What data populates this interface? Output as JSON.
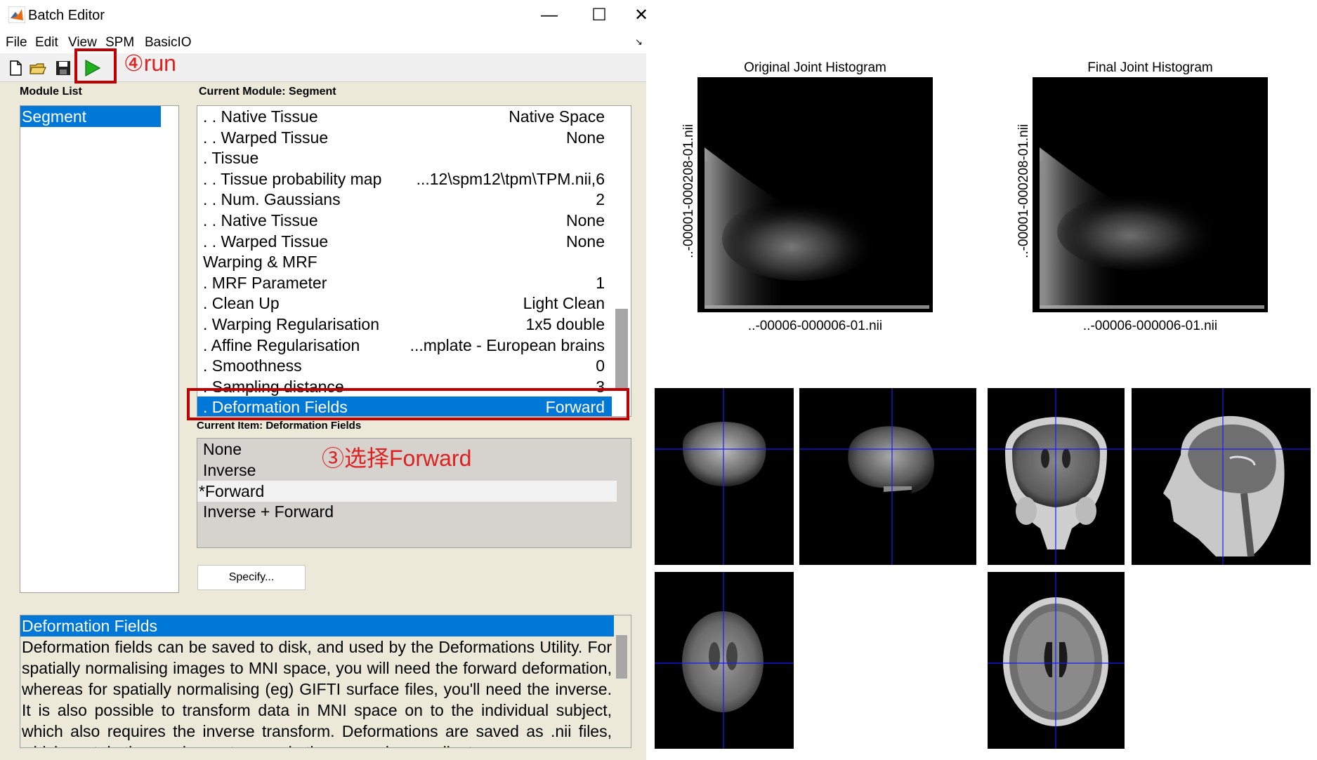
{
  "window": {
    "title": "Batch Editor",
    "controls": {
      "minimize": "—",
      "maximize": "☐",
      "close": "✕"
    }
  },
  "menu": [
    "File",
    "Edit",
    "View",
    "SPM",
    "BasicIO"
  ],
  "panels": {
    "module_list_label": "Module List",
    "current_module_label": "Current Module: Segment",
    "current_item_label": "Current Item: Deformation Fields"
  },
  "module_list": [
    "Segment"
  ],
  "current_module_rows": [
    {
      "label": ". . Native Tissue",
      "value": "Native Space"
    },
    {
      "label": ". . Warped Tissue",
      "value": "None"
    },
    {
      "label": ". Tissue",
      "value": ""
    },
    {
      "label": ". . Tissue probability map",
      "value": "...12\\spm12\\tpm\\TPM.nii,6"
    },
    {
      "label": ". . Num. Gaussians",
      "value": "2"
    },
    {
      "label": ". . Native Tissue",
      "value": "None"
    },
    {
      "label": ". . Warped Tissue",
      "value": "None"
    },
    {
      "label": "Warping & MRF",
      "value": ""
    },
    {
      "label": ". MRF Parameter",
      "value": "1"
    },
    {
      "label": ". Clean Up",
      "value": "Light Clean"
    },
    {
      "label": ". Warping Regularisation",
      "value": "1x5 double"
    },
    {
      "label": ". Affine Regularisation",
      "value": "...mplate - European brains"
    },
    {
      "label": ". Smoothness",
      "value": "0"
    },
    {
      "label": ". Sampling distance",
      "value": "3"
    },
    {
      "label": ". Deformation Fields",
      "value": "Forward"
    }
  ],
  "current_item_options": [
    "None",
    "Inverse",
    "*Forward",
    "Inverse + Forward"
  ],
  "specify_button": "Specify...",
  "help": {
    "heading": "Deformation Fields",
    "text": "Deformation fields can be saved to disk, and used by the Deformations Utility. For spatially normalising images to MNI space, you will need the forward deformation, whereas for spatially normalising (eg) GIFTI surface files, you'll need the inverse. It is also possible to transform data in MNI space on to the individual subject, which also requires the inverse transform. Deformations are saved as .nii files, which contain three volumes to encode the x, y and z coordinates."
  },
  "annotations": {
    "run": "④run",
    "select_forward": "③选择Forward",
    "color": "#e02020",
    "box_color": "#c00000"
  },
  "figure": {
    "hist_left_title": "Original Joint Histogram",
    "hist_right_title": "Final Joint Histogram",
    "x_label": "..-00006-000006-01.nii",
    "y_label": "..-00001-000208-01.nii",
    "crosshair_color": "#1a1aff"
  },
  "colors": {
    "selection": "#0078d7",
    "window_bg": "#ece9d8",
    "run_icon": "#22b022"
  }
}
